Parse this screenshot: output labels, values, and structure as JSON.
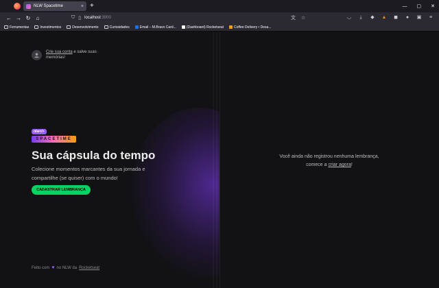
{
  "browser": {
    "tab_title": "NLW Spacetime",
    "tab_close": "×",
    "new_tab": "+",
    "url_host": "localhost",
    "url_port": ":3000",
    "window_controls": [
      "—",
      "▢",
      "✕"
    ]
  },
  "bookmarks": [
    {
      "label": "Ferramentas",
      "type": "folder"
    },
    {
      "label": "Investimentos",
      "type": "folder"
    },
    {
      "label": "Desenvolvimento",
      "type": "folder"
    },
    {
      "label": "Curiosidades",
      "type": "folder"
    },
    {
      "label": "Email – M.Bravo Card...",
      "type": "link",
      "color": "#1a73e8"
    },
    {
      "label": "(Dashboard) Rocketseat",
      "type": "link",
      "color": "#8257e5"
    },
    {
      "label": "Coffee Delivery • Desa...",
      "type": "link",
      "color": "#f59e0b"
    }
  ],
  "signin": {
    "link": "Crie sua conta",
    "rest": " e salve suas memórias!"
  },
  "logo": {
    "badge": "nlw</>",
    "word": "SPACETIME"
  },
  "hero": {
    "title": "Sua cápsula do tempo",
    "subtitle": "Colecione momentos marcantes da sua jornada e compartilhe (se quiser) com o mundo!",
    "cta": "Cadastrar lembrança"
  },
  "footer": {
    "prefix": "Feito com",
    "middle": "no NLW da",
    "link": "Rocketseat"
  },
  "empty_state": {
    "line1": "Você ainda não registrou nenhuma lembrança,",
    "line2_prefix": "comece a ",
    "line2_link": "criar agora",
    "line2_suffix": "!"
  },
  "colors": {
    "background": "#121215",
    "accent_green": "#04d361",
    "accent_purple": "#9b5cff"
  }
}
